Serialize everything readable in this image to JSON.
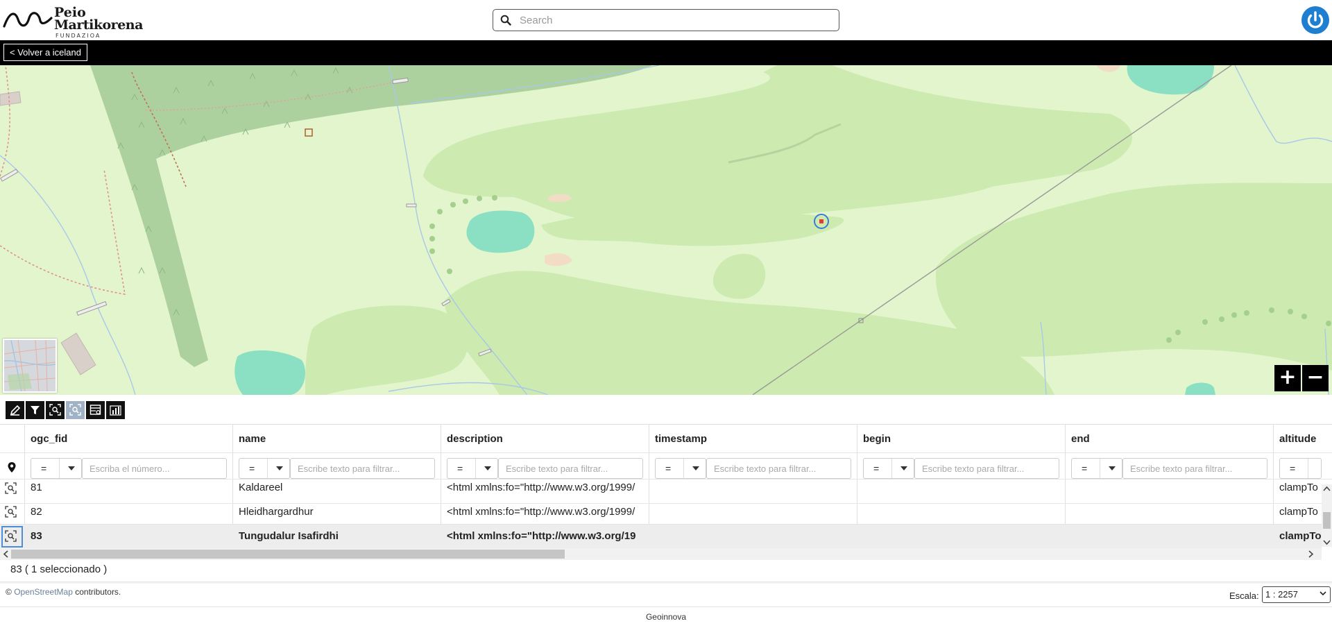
{
  "header": {
    "logo_line1": "Peio",
    "logo_line2": "Martikorena",
    "logo_line3": "FUNDAZIOA",
    "search_placeholder": "Search"
  },
  "nav": {
    "back_label": "< Volver a iceland"
  },
  "map": {
    "zoom_in": "+",
    "zoom_out": "−",
    "icons": [
      "search-icon",
      "power-icon",
      "zoom-in-icon",
      "zoom-out-icon",
      "location-marker-icon"
    ]
  },
  "toolbar": {
    "tools": [
      "edit-icon",
      "filter-icon",
      "zoom-selection-icon",
      "zoom-to-row-icon",
      "table-settings-icon",
      "chart-icon"
    ]
  },
  "table": {
    "columns": [
      "ogc_fid",
      "name",
      "description",
      "timestamp",
      "begin",
      "end",
      "altitude"
    ],
    "filters": {
      "operator": "=",
      "number_placeholder": "Escriba el número...",
      "text_placeholder": "Escribe texto para filtrar..."
    },
    "rows": [
      {
        "ogc_fid": "81",
        "name": "Kaldareel",
        "description": "<html xmlns:fo=\"http://www.w3.org/1999/",
        "timestamp": "",
        "begin": "",
        "end": "",
        "altitude": "clampTo",
        "selected": false
      },
      {
        "ogc_fid": "82",
        "name": "Hleidhargardhur",
        "description": "<html xmlns:fo=\"http://www.w3.org/1999/",
        "timestamp": "",
        "begin": "",
        "end": "",
        "altitude": "clampTo",
        "selected": false
      },
      {
        "ogc_fid": "83",
        "name": "Tungudalur Isafirdhi",
        "description": "<html xmlns:fo=\"http://www.w3.org/19",
        "timestamp": "",
        "begin": "",
        "end": "",
        "altitude": "clampTo",
        "selected": true
      }
    ],
    "count_text": "83 ( 1 seleccionado )"
  },
  "footer": {
    "attribution_prefix": "© ",
    "attribution_link": "OpenStreetMap",
    "attribution_suffix": " contributors.",
    "scale_label": "Escala:",
    "scale_value": "1 : 2257",
    "credit": "Geoinnova"
  },
  "colors": {
    "map_background": "#e3f5cd",
    "forest": "#add19e",
    "grass": "#cdebb0",
    "water": "#8bdfc3",
    "marker_ring": "#3b7bd8",
    "marker_dot": "#e53935",
    "accent": "#1e7fd1"
  }
}
